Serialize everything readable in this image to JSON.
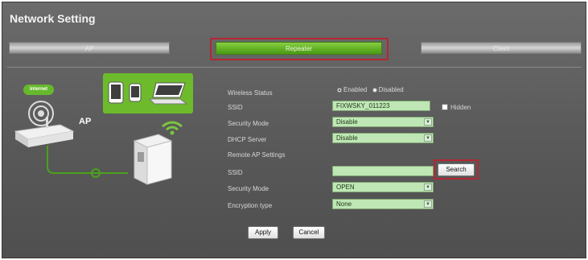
{
  "window": {
    "title": "Network Setting"
  },
  "tabs": [
    {
      "label": "AP"
    },
    {
      "label": "Repeater"
    },
    {
      "label": "Client"
    }
  ],
  "illustration": {
    "internet_label": "Internet",
    "ap_label": "AP"
  },
  "form": {
    "wireless_status": {
      "label": "Wireless Status",
      "options": [
        "Enabled",
        "Disabled"
      ],
      "selected": "Enabled"
    },
    "ssid": {
      "label": "SSID",
      "value": "FIXWSKY_011223",
      "hidden_label": "Hidden"
    },
    "security_mode": {
      "label": "Security Mode",
      "value": "Disable"
    },
    "dhcp_server": {
      "label": "DHCP Server",
      "value": "Disable"
    },
    "remote_ap_settings": {
      "label": "Remote AP Settings"
    },
    "remote_ssid": {
      "label": "SSID",
      "value": "",
      "search_label": "Search"
    },
    "remote_security_mode": {
      "label": "Security Mode",
      "value": "OPEN"
    },
    "encryption_type": {
      "label": "Encryption type",
      "value": "None"
    }
  },
  "buttons": {
    "apply": "Apply",
    "cancel": "Cancel"
  },
  "colors": {
    "panel": "#595959",
    "accent_green": "#62b023",
    "field_green": "#bfe6b5",
    "highlight_red": "#b52732"
  }
}
